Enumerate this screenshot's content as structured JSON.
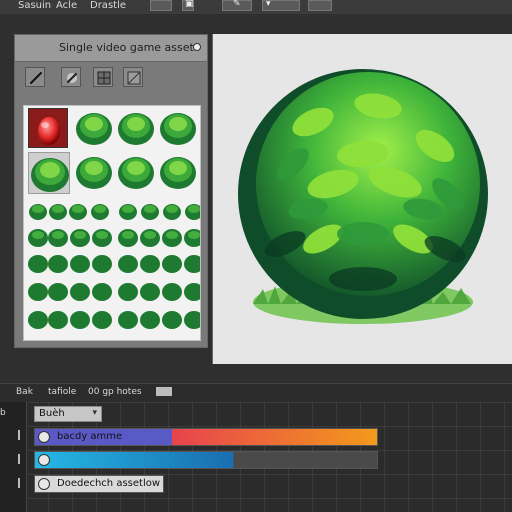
{
  "top_menu": {
    "items": [
      "Sasuin",
      "Acle",
      "Drastle"
    ]
  },
  "asset_panel": {
    "title": "Single video game asset",
    "tools": [
      "pen-tool",
      "dropper-tool",
      "grid-tool",
      "blend-tool"
    ]
  },
  "bottom_tabs": {
    "items": [
      "Bak",
      "tafiole",
      "00 gp hotes"
    ],
    "left_label": "b"
  },
  "timeline": {
    "dropdown_value": "Buèh",
    "track_1_label": "bacdy amme",
    "track_3_label": "Doedechch assetlow"
  },
  "colors": {
    "track_1_gradient": [
      "#5a5ac7",
      "#e7434e",
      "#f39a1b"
    ],
    "track_2_gradient": [
      "#25b8e6",
      "#1a6db0"
    ],
    "bush_light": "#8fe03a",
    "bush_dark": "#0f4d2a"
  }
}
